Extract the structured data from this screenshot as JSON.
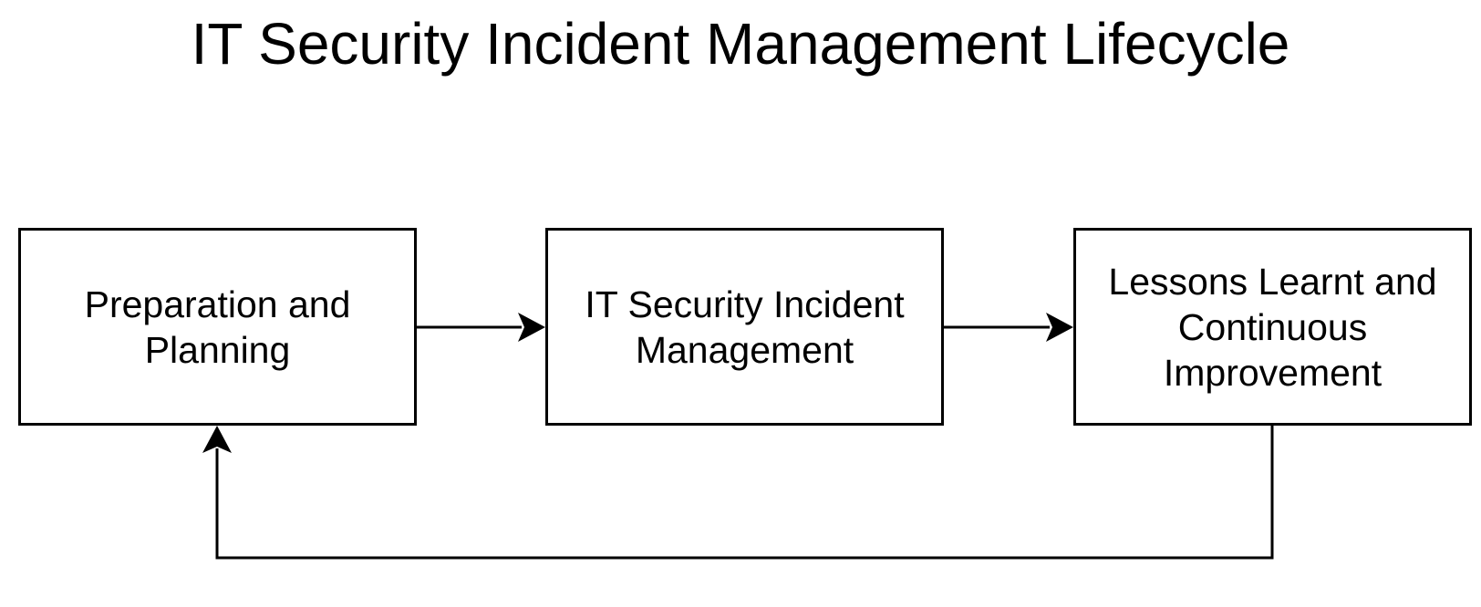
{
  "diagram": {
    "title": "IT Security Incident Management Lifecycle",
    "nodes": [
      {
        "id": "prep",
        "label": "Preparation and\nPlanning"
      },
      {
        "id": "mgmt",
        "label": "IT Security Incident\nManagement"
      },
      {
        "id": "lessons",
        "label": "Lessons Learnt and\nContinuous\nImprovement"
      }
    ],
    "edges": [
      {
        "from": "prep",
        "to": "mgmt"
      },
      {
        "from": "mgmt",
        "to": "lessons"
      },
      {
        "from": "lessons",
        "to": "prep"
      }
    ]
  }
}
